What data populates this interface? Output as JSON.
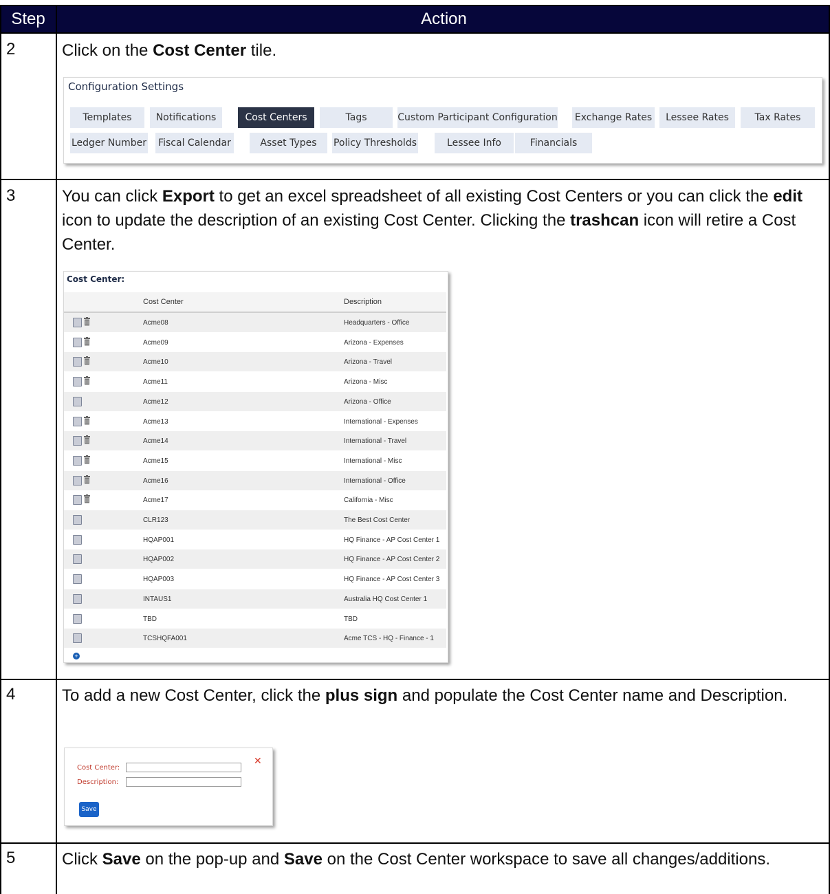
{
  "header": {
    "step": "Step",
    "action": "Action"
  },
  "steps": [
    {
      "num": "2",
      "text_before": "Click on the ",
      "bold": "Cost Center",
      "text_after": " tile."
    },
    {
      "num": "3"
    },
    {
      "num": "4"
    },
    {
      "num": "5"
    }
  ],
  "step3": {
    "t1": "You can click ",
    "b1": "Export",
    "t2": " to get an excel spreadsheet of all existing Cost Centers or you can click the ",
    "b2": "edit",
    "t3": " icon to update the description of an existing Cost Center. Clicking the ",
    "b3": "trashcan",
    "t4": " icon will retire a Cost Center."
  },
  "step4": {
    "t1": "To add a new Cost Center, click the ",
    "b1": "plus sign",
    "t2": " and populate the Cost Center name and Description."
  },
  "step5": {
    "t1": "Click ",
    "b1": "Save",
    "t2": " on the pop-up and ",
    "b2": "Save",
    "t3": " on the Cost Center workspace to save all changes/additions."
  },
  "config": {
    "title": "Configuration Settings",
    "row1": [
      "Templates",
      "Notifications",
      "Cost Centers",
      "Tags",
      "Custom Participant Configuration",
      "Exchange Rates",
      "Lessee Rates",
      "Tax Rates"
    ],
    "row2": [
      "Ledger Number",
      "Fiscal Calendar",
      "Asset Types",
      "Policy Thresholds",
      "Lessee Info",
      "Financials"
    ],
    "active": "Cost Centers"
  },
  "cost_center": {
    "title": "Cost Center:",
    "col_name": "Cost Center",
    "col_desc": "Description",
    "rows": [
      {
        "name": "Acme08",
        "desc": "Headquarters - Office",
        "trash": true
      },
      {
        "name": "Acme09",
        "desc": "Arizona - Expenses",
        "trash": true
      },
      {
        "name": "Acme10",
        "desc": "Arizona - Travel",
        "trash": true
      },
      {
        "name": "Acme11",
        "desc": "Arizona - Misc",
        "trash": true
      },
      {
        "name": "Acme12",
        "desc": "Arizona - Office",
        "trash": false
      },
      {
        "name": "Acme13",
        "desc": "International - Expenses",
        "trash": true
      },
      {
        "name": "Acme14",
        "desc": "International - Travel",
        "trash": true
      },
      {
        "name": "Acme15",
        "desc": "International - Misc",
        "trash": true
      },
      {
        "name": "Acme16",
        "desc": "International - Office",
        "trash": true
      },
      {
        "name": "Acme17",
        "desc": "California - Misc",
        "trash": true
      },
      {
        "name": "CLR123",
        "desc": "The Best Cost Center",
        "trash": false
      },
      {
        "name": "HQAP001",
        "desc": "HQ Finance - AP Cost Center 1",
        "trash": false
      },
      {
        "name": "HQAP002",
        "desc": "HQ Finance - AP Cost Center 2",
        "trash": false
      },
      {
        "name": "HQAP003",
        "desc": "HQ Finance - AP Cost Center 3",
        "trash": false
      },
      {
        "name": "INTAUS1",
        "desc": "Australia HQ Cost Center 1",
        "trash": false
      },
      {
        "name": "TBD",
        "desc": "TBD",
        "trash": false
      },
      {
        "name": "TCSHQFA001",
        "desc": "Acme TCS - HQ - Finance - 1",
        "trash": false
      }
    ],
    "add_icon": "plus-circle-icon"
  },
  "popup": {
    "label_cc": "Cost Center:",
    "label_desc": "Description:",
    "save": "Save",
    "close_icon": "close-icon"
  }
}
